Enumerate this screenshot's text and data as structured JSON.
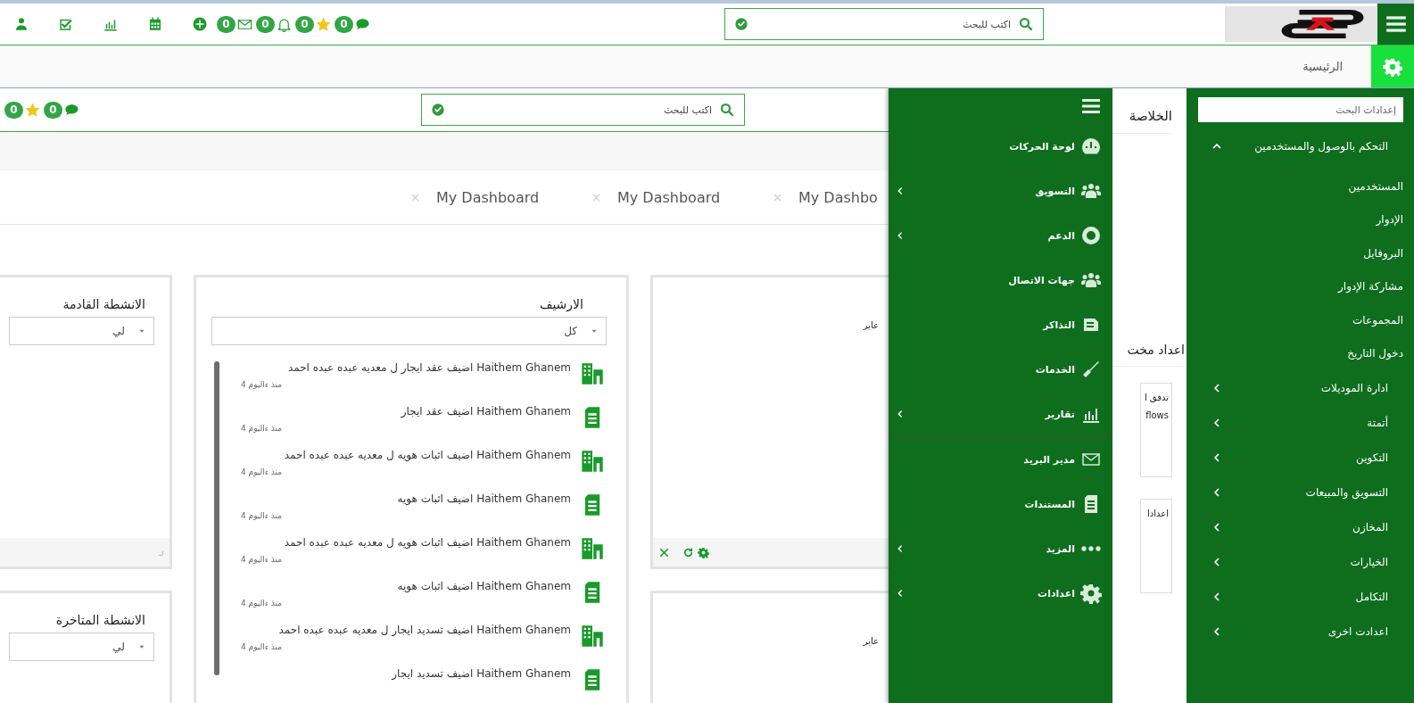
{
  "top_bar": {
    "counters": [
      {
        "count": "0"
      },
      {
        "count": "0"
      },
      {
        "count": "0"
      },
      {
        "count": "0"
      }
    ],
    "search": {
      "placeholder": "اكتب للبحث"
    }
  },
  "breadcrumb": {
    "label": "الرئيسية"
  },
  "inner_bar": {
    "counters": [
      {
        "count": "0"
      },
      {
        "count": "0"
      }
    ],
    "search": {
      "placeholder": "اكتب للبحث"
    }
  },
  "tabs": [
    {
      "label": "My Dashbo"
    },
    {
      "label": "My Dashboard"
    },
    {
      "label": "My Dashboard"
    }
  ],
  "panels": {
    "upcoming": {
      "title": "الانشطة القادمة",
      "filter": "لي"
    },
    "overdue": {
      "title": "الانشطة المتاخرة",
      "filter": "لي"
    },
    "archive": {
      "title": "الارشيف",
      "filter": "كل",
      "items": [
        {
          "kind": "property",
          "text": "Haithem Ghanem اضيف عقد ايجار ل معديه عبده عبده احمد",
          "time": "منذ ءاليوم 4"
        },
        {
          "kind": "document",
          "text": "Haithem Ghanem اضيف عقد ايجار",
          "time": "منذ ءاليوم 4"
        },
        {
          "kind": "property",
          "text": "Haithem Ghanem اضيف اثبات هويه ل معديه عبده عبده احمد",
          "time": "منذ ءاليوم 4"
        },
        {
          "kind": "document",
          "text": "Haithem Ghanem اضيف اثبات هويه",
          "time": "منذ ءاليوم 4"
        },
        {
          "kind": "property",
          "text": "Haithem Ghanem اضيف اثبات هويه ل معديه عبده عبده احمد",
          "time": "منذ ءاليوم 4"
        },
        {
          "kind": "document",
          "text": "Haithem Ghanem اضيف اثبات هويه",
          "time": "منذ ءاليوم 4"
        },
        {
          "kind": "property",
          "text": "Haithem Ghanem اضيف تسديد ايجار ل معديه عبده عبده احمد",
          "time": "منذ ءاليوم 4"
        },
        {
          "kind": "document",
          "text": "Haithem Ghanem اضيف تسديد ايجار"
        }
      ]
    },
    "right_panels": [
      {
        "text": "عاير"
      },
      {
        "text": "عاير"
      }
    ]
  },
  "summary": {
    "title": "الخلاصة",
    "section": "اعداد مخت",
    "cards": [
      {
        "lines": [
          "تدفق ا",
          "flows"
        ]
      },
      {
        "lines": [
          "اعدادا"
        ]
      }
    ]
  },
  "menu": {
    "groups": [
      [
        {
          "label": "لوحة الحركات",
          "submenu": false
        },
        {
          "label": "التسويق",
          "submenu": true
        },
        {
          "label": "الدعم",
          "submenu": true
        },
        {
          "label": "جهات الاتصال",
          "submenu": false
        },
        {
          "label": "التذاكر",
          "submenu": false
        },
        {
          "label": "الخدمات",
          "submenu": false
        },
        {
          "label": "تقارير",
          "submenu": true
        }
      ],
      [
        {
          "label": "مدير البريد",
          "submenu": false
        },
        {
          "label": "المستندات",
          "submenu": false
        },
        {
          "label": "المزيد",
          "submenu": true
        },
        {
          "label": "اعدادات",
          "submenu": true
        }
      ]
    ]
  },
  "sidebar": {
    "search": {
      "placeholder": "إعدادات البحث"
    },
    "items": [
      {
        "label": "التحكم بالوصول والمستخدمين",
        "expanded": true,
        "children": [
          {
            "label": "المستخدمين"
          },
          {
            "label": "الإدوار"
          },
          {
            "label": "البروفايل"
          },
          {
            "label": "مشاركة الإدوار"
          },
          {
            "label": "المجموعات"
          },
          {
            "label": "دخول التاريخ"
          }
        ]
      },
      {
        "label": "ادارة الموديلات",
        "expanded": false
      },
      {
        "label": "أتمتة",
        "expanded": false
      },
      {
        "label": "التكوين",
        "expanded": false
      },
      {
        "label": "التسويق والمبيعات",
        "expanded": false
      },
      {
        "label": "المخازن",
        "expanded": false
      },
      {
        "label": "الخيارات",
        "expanded": false
      },
      {
        "label": "التكامل",
        "expanded": false
      },
      {
        "label": "اعدادت اخرى",
        "expanded": false
      }
    ]
  }
}
